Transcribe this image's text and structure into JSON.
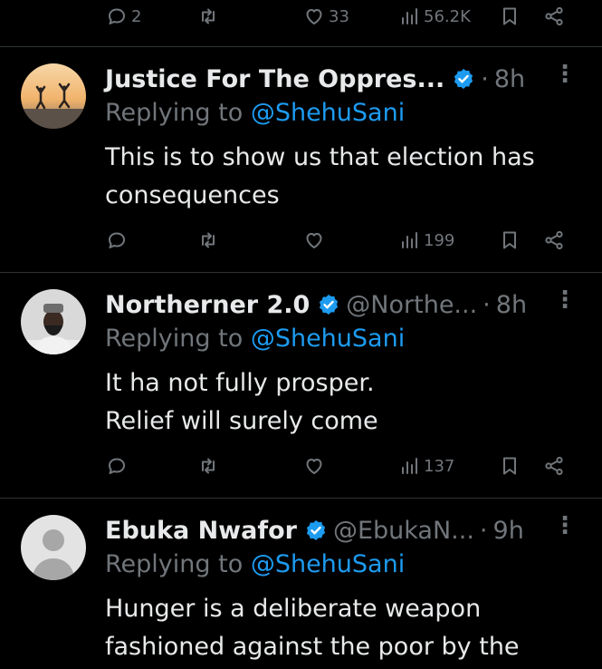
{
  "top_bar": {
    "replies": "2",
    "likes": "33",
    "views": "56.2K"
  },
  "posts": [
    {
      "name": "Justice For The Oppres...",
      "handle": "",
      "time": "8h",
      "reply_prefix": "Replying to",
      "reply_to": "@ShehuSani",
      "lines": [
        "This is to show us that election has",
        "consequences"
      ],
      "views": "199"
    },
    {
      "name": "Northerner 2.0",
      "handle": "@Northe...",
      "time": "8h",
      "reply_prefix": "Replying to",
      "reply_to": "@ShehuSani",
      "lines": [
        "It ha not fully prosper.",
        "Relief will surely come"
      ],
      "views": "137"
    },
    {
      "name": "Ebuka Nwafor",
      "handle": "@EbukaN...",
      "time": "9h",
      "reply_prefix": "Replying to",
      "reply_to": "@ShehuSani",
      "lines": [
        "Hunger is a deliberate weapon",
        "fashioned against the poor by the"
      ],
      "views": ""
    }
  ],
  "separator": "·",
  "more_glyph": "⋮",
  "colors": {
    "background": "#000000",
    "text": "#e7e9ea",
    "secondary": "#71767b",
    "accent": "#1d9bf0",
    "divider": "#2f3336"
  },
  "icons": [
    "reply-icon",
    "repost-icon",
    "like-icon",
    "views-icon",
    "bookmark-icon",
    "share-icon",
    "verified-icon",
    "more-icon"
  ]
}
